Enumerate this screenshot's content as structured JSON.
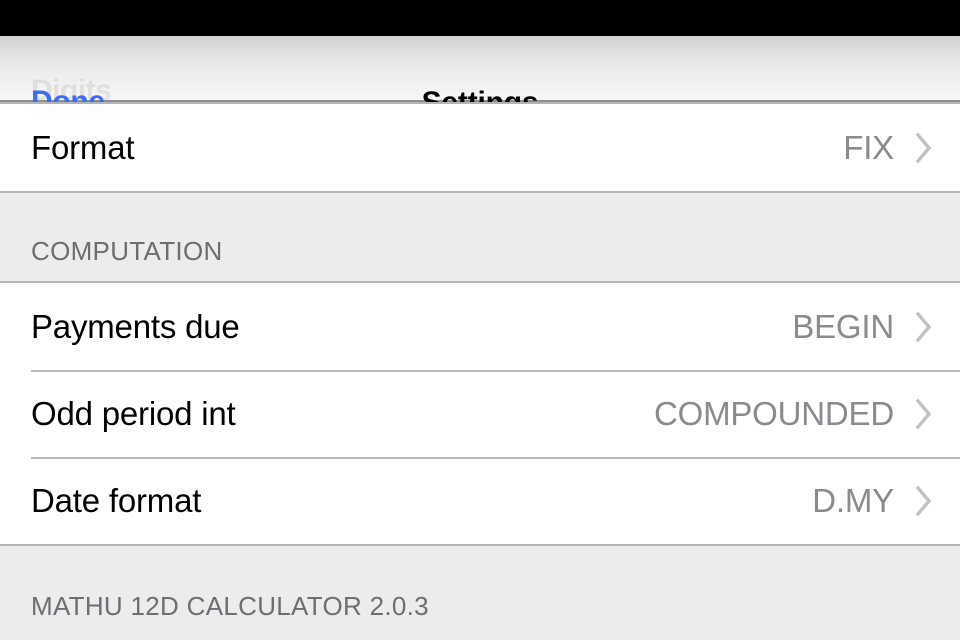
{
  "nav": {
    "back_ghost_label": "Digits",
    "done_label": "Done",
    "title": "Settings"
  },
  "colors": {
    "tint_blue": "#3d6cf0",
    "value_gray": "#8a8a8f",
    "header_gray": "#6d6d72",
    "separator": "#b8b8bc",
    "group_background": "#ffffff",
    "page_background": "#ececed",
    "status_bar": "#000000"
  },
  "sections": [
    {
      "header": "",
      "rows": [
        {
          "label": "Format",
          "value": "FIX",
          "accessory": "chevron-right-icon"
        }
      ]
    },
    {
      "header": "COMPUTATION",
      "rows": [
        {
          "label": "Payments due",
          "value": "BEGIN",
          "accessory": "chevron-right-icon"
        },
        {
          "label": "Odd period int",
          "value": "COMPOUNDED",
          "accessory": "chevron-right-icon"
        },
        {
          "label": "Date format",
          "value": "D.MY",
          "accessory": "chevron-right-icon"
        }
      ]
    }
  ],
  "footer": {
    "text": "MATHU 12D CALCULATOR 2.0.3"
  }
}
